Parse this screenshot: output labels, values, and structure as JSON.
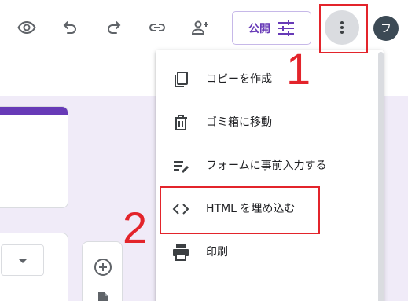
{
  "toolbar": {
    "icons": [
      "preview-eye-icon",
      "undo-icon",
      "redo-icon",
      "link-icon",
      "add-collaborator-icon",
      "more-vert-icon"
    ],
    "publish_label": "公開",
    "avatar_initial": "フ"
  },
  "menu": {
    "items": [
      {
        "label": "コピーを作成",
        "icon": "copy-icon"
      },
      {
        "label": "ゴミ箱に移動",
        "icon": "trash-icon"
      },
      {
        "label": "フォームに事前入力する",
        "icon": "prefill-icon"
      },
      {
        "label": "HTML を埋め込む",
        "icon": "code-icon"
      },
      {
        "label": "印刷",
        "icon": "print-icon"
      }
    ]
  },
  "annotations": {
    "step1": "1",
    "step2": "2",
    "color": "#e3242b"
  },
  "colors": {
    "accent": "#673ab7",
    "background": "#f0ebf8",
    "icon": "#5f6368"
  }
}
